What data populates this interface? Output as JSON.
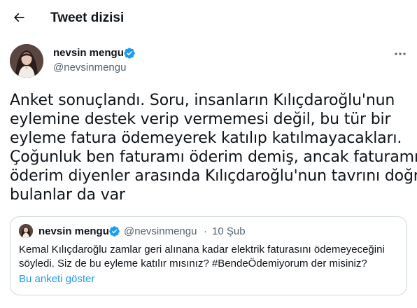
{
  "header": {
    "title": "Tweet dizisi",
    "back_icon": "arrow-left-icon"
  },
  "author": {
    "name": "nevsin mengu",
    "handle": "@nevsinmengu",
    "verified": true,
    "badge_color": "#1d9bf0"
  },
  "tweet": {
    "lines": [
      "Anket sonuçlandı. Soru, insanların Kılıçdaroğlu'nun",
      "eylemine destek verip vermemesi değil, bu tür bir",
      "eyleme fatura ödemeyerek katılıp katılmayacakları.",
      "Çoğunluk ben faturamı öderim demiş, ancak faturamı",
      "öderim diyenler arasında Kılıçdaroğlu'nun tavrını doğru",
      "bulanlar da var"
    ]
  },
  "quote": {
    "name": "nevsin mengu",
    "handle": "@nevsinmengu",
    "separator": "·",
    "date": "10 Şub",
    "lines": [
      "Kemal Kılıçdaroğlu zamlar geri alınana kadar elektrik faturasını ödemeyeceğini",
      "söyledi. Siz de bu eyleme katılır mısınız? #BendeÖdemiyorum der misiniz?"
    ],
    "link_label": "Bu anketi göster",
    "link_color": "#1d9bf0"
  },
  "colors": {
    "text": "#0f1419",
    "secondary": "#536471",
    "border": "#cfd9de",
    "accent": "#1d9bf0"
  }
}
